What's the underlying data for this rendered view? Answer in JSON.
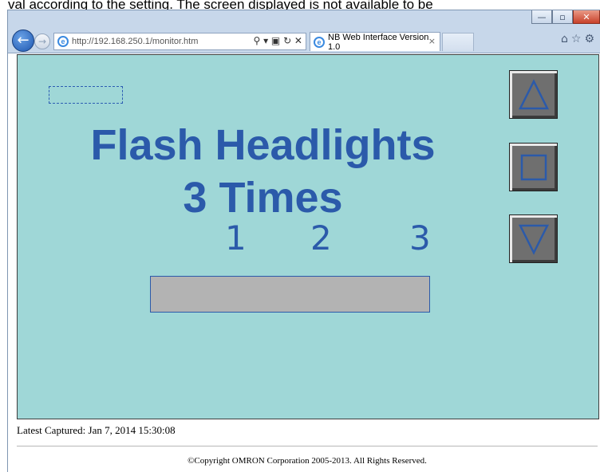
{
  "caption": {
    "text": "val according to the setting. The screen displayed is not available to be"
  },
  "browser": {
    "url_host": "http://192.168.250.1/",
    "url_path": "monitor.htm",
    "address_tools": "⚲ ▾ ▣ ↻ ✕",
    "tab_title": "NB Web Interface Version 1.0",
    "tab_close": "×",
    "right_tools": "⌂☆⚙"
  },
  "hmi": {
    "headline_line1": "Flash Headlights",
    "headline_line2": "3 Times",
    "count_labels": [
      "1",
      "2",
      "3"
    ],
    "progress_value": 0,
    "colors": {
      "panel_bg": "#9fd7d7",
      "accent": "#2b5aaa",
      "bar": "#b3b3b3",
      "button": "#6f6f6f"
    },
    "buttons": {
      "up_icon": "triangle-up-icon",
      "stop_icon": "square-icon",
      "down_icon": "triangle-down-icon"
    }
  },
  "footer": {
    "latest_captured": "Latest Captured: Jan 7, 2014 15:30:08",
    "copyright": "©Copyright OMRON Corporation 2005-2013. All Rights Reserved."
  }
}
